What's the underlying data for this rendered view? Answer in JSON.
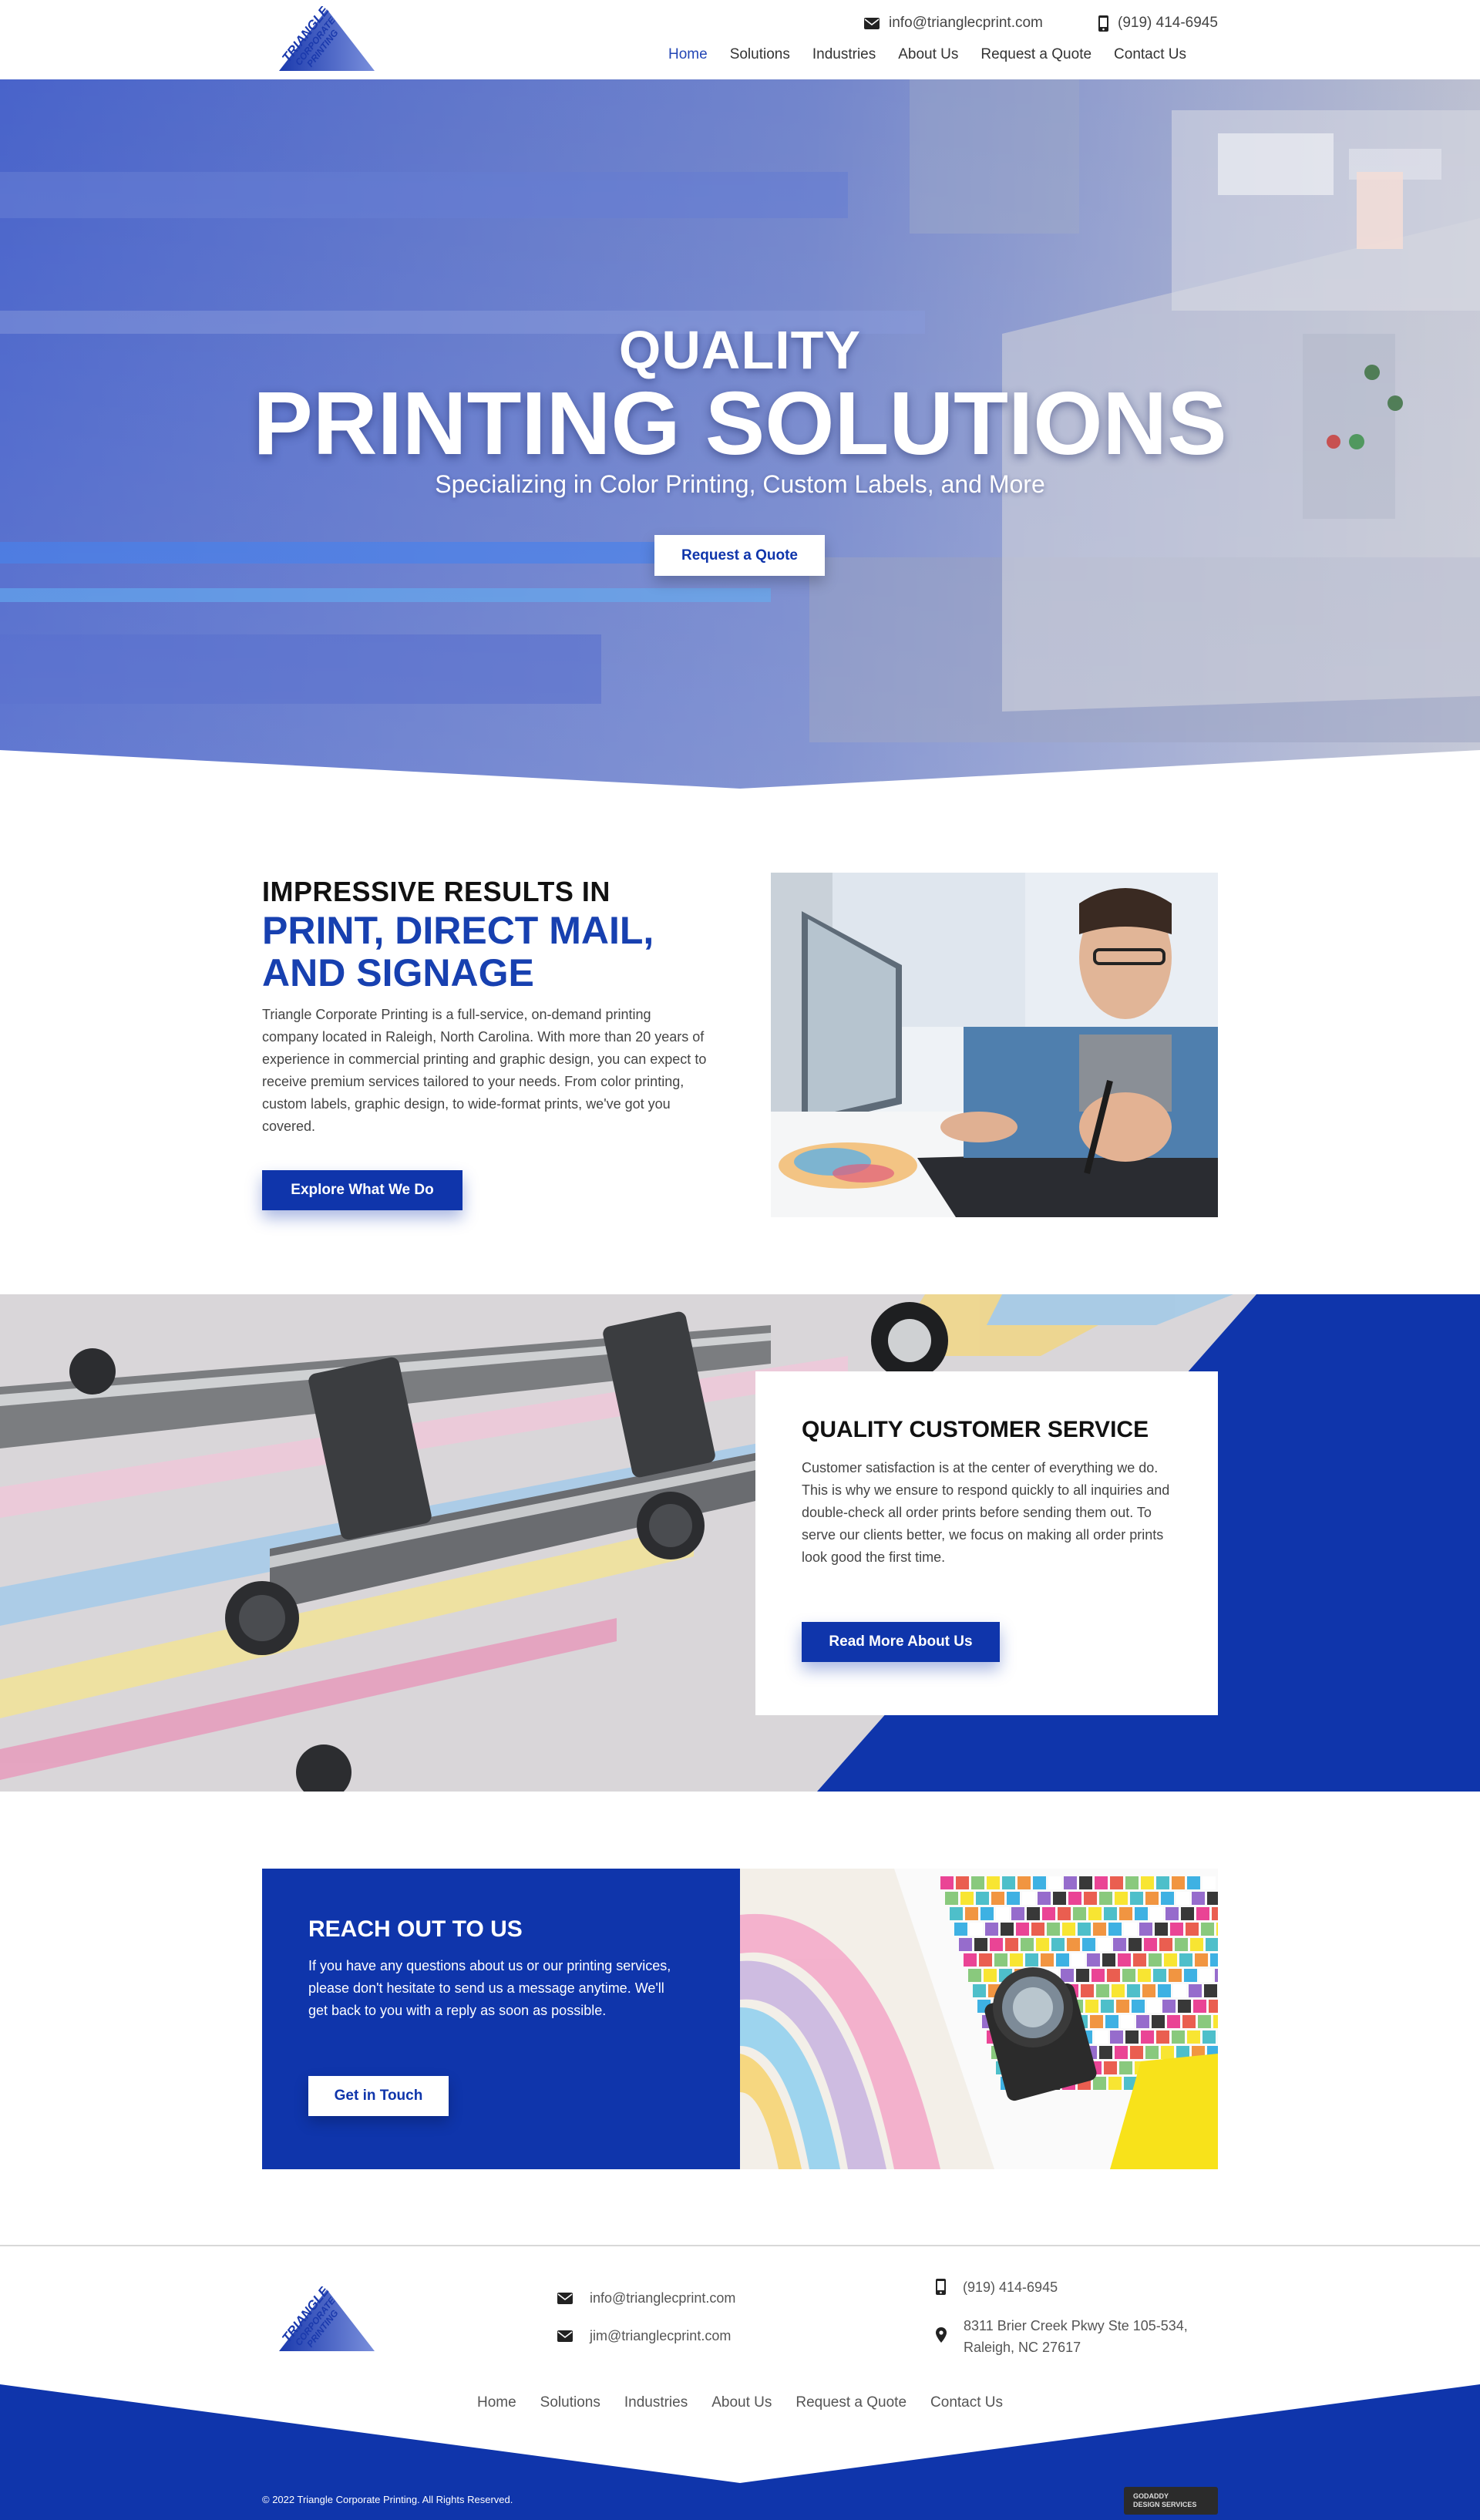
{
  "header": {
    "logo_text_lines": [
      "TRIANGLE",
      "CORPORATE",
      "PRINTING"
    ],
    "email": "info@trianglecprint.com",
    "phone": "(919) 414-6945",
    "icons": {
      "email": "envelope-icon",
      "phone": "mobile-phone-icon"
    },
    "nav": [
      {
        "label": "Home",
        "active": true
      },
      {
        "label": "Solutions",
        "active": false
      },
      {
        "label": "Industries",
        "active": false
      },
      {
        "label": "About Us",
        "active": false
      },
      {
        "label": "Request a Quote",
        "active": false
      },
      {
        "label": "Contact Us",
        "active": false
      }
    ]
  },
  "hero": {
    "title_line1": "QUALITY",
    "title_line2": "PRINTING SOLUTIONS",
    "subtitle": "Specializing in Color Printing, Custom Labels, and More",
    "cta_label": "Request a Quote"
  },
  "intro": {
    "heading_line1": "IMPRESSIVE RESULTS IN",
    "heading_line2": "PRINT, DIRECT MAIL,",
    "heading_line3": "AND SIGNAGE",
    "body": "Triangle Corporate Printing is a full-service, on-demand printing company located in Raleigh, North Carolina. With more than 20 years of experience in commercial printing and graphic design, you can expect to receive premium services tailored to your needs. From color printing, custom labels, graphic design, to wide-format prints, we've got you covered.",
    "cta_label": "Explore What We Do"
  },
  "service": {
    "heading": "QUALITY CUSTOMER SERVICE",
    "body": "Customer satisfaction is at the center of everything we do. This is why we ensure to respond quickly to all inquiries and double-check all order prints before sending them out. To serve our clients better, we focus on making all order prints look good the first time.",
    "cta_label": "Read More About Us"
  },
  "reach": {
    "heading": "REACH OUT TO US",
    "body": "If you have any questions about us or our printing services, please don't hesitate to send us a message anytime. We'll get back to you with a reply as soon as possible.",
    "cta_label": "Get in Touch"
  },
  "footer": {
    "email1": "info@trianglecprint.com",
    "email2": "jim@trianglecprint.com",
    "phone": "(919) 414-6945",
    "address_line1": "8311 Brier Creek Pkwy Ste 105-534,",
    "address_line2": "Raleigh, NC 27617",
    "icons": {
      "email": "envelope-icon",
      "phone": "mobile-phone-icon",
      "address": "map-pin-icon"
    },
    "nav": [
      "Home",
      "Solutions",
      "Industries",
      "About Us",
      "Request a Quote",
      "Contact Us"
    ],
    "copyright": "© 2022 Triangle Corporate Printing. All Rights Reserved.",
    "badge_line1": "GODADDY",
    "badge_line2": "DESIGN SERVICES"
  },
  "colors": {
    "brand_blue": "#0f35ab",
    "text_dark": "#111111",
    "nav_active": "#2346b5"
  }
}
